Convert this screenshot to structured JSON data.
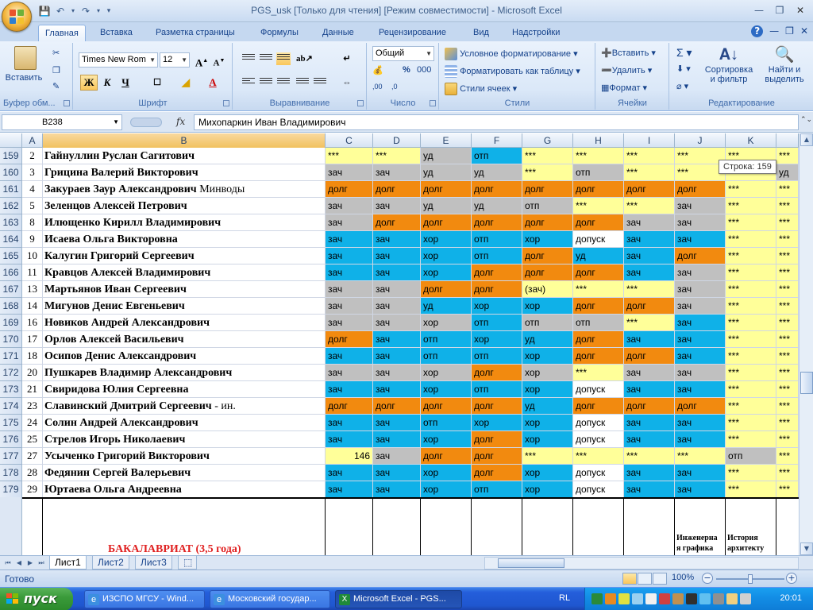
{
  "window": {
    "title": "PGS_usk  [Только для чтения]  [Режим совместимости] - Microsoft Excel"
  },
  "qat": {
    "save_icon": "save-icon",
    "undo_icon": "undo-icon",
    "redo_icon": "redo-icon"
  },
  "ribbon_tabs": [
    "Главная",
    "Вставка",
    "Разметка страницы",
    "Формулы",
    "Данные",
    "Рецензирование",
    "Вид",
    "Надстройки"
  ],
  "ribbon": {
    "clipboard": {
      "paste": "Вставить",
      "label": "Буфер обм..."
    },
    "font": {
      "name": "Times New Rom",
      "size": "12",
      "bold": "Ж",
      "italic": "К",
      "underline": "Ч",
      "label": "Шрифт"
    },
    "alignment": {
      "label": "Выравнивание"
    },
    "number": {
      "format": "Общий",
      "percent": "%",
      "thousands": "000",
      "label": "Число"
    },
    "styles": {
      "conditional": "Условное форматирование",
      "as_table": "Форматировать как таблицу",
      "cell_styles": "Стили ячеек",
      "label": "Стили"
    },
    "cells": {
      "insert": "Вставить",
      "delete": "Удалить",
      "format": "Формат",
      "label": "Ячейки"
    },
    "editing": {
      "sort_line1": "Сортировка",
      "sort_line2": "и фильтр",
      "find_line1": "Найти и",
      "find_line2": "выделить",
      "label": "Редактирование"
    }
  },
  "formula_bar": {
    "name_box": "B238",
    "fx": "fx",
    "content": "Михопаркин Иван Владимирович"
  },
  "columns": [
    "A",
    "B",
    "C",
    "D",
    "E",
    "F",
    "G",
    "H",
    "I",
    "J",
    "K"
  ],
  "rows": [
    {
      "row": "159",
      "a": "2",
      "name": "Гайнуллин Руслан Сагитович",
      "extra": "",
      "cells": [
        [
          "***",
          "y"
        ],
        [
          "***",
          "y"
        ],
        [
          "уд",
          "g"
        ],
        [
          "отп",
          "b"
        ],
        [
          "***",
          "y"
        ],
        [
          "***",
          "y"
        ],
        [
          "***",
          "y"
        ],
        [
          "***",
          "y"
        ],
        [
          "***",
          "y"
        ],
        [
          "***",
          "y"
        ]
      ]
    },
    {
      "row": "160",
      "a": "3",
      "name": "Грицина Валерий Викторович",
      "extra": "",
      "cells": [
        [
          "зач",
          "g"
        ],
        [
          "зач",
          "g"
        ],
        [
          "уд",
          "g"
        ],
        [
          "уд",
          "g"
        ],
        [
          "***",
          "y"
        ],
        [
          "отп",
          "g"
        ],
        [
          "***",
          "y"
        ],
        [
          "***",
          "y"
        ],
        [
          "",
          "y"
        ],
        [
          "уд",
          "g"
        ]
      ]
    },
    {
      "row": "161",
      "a": "4",
      "name": "Закураев Заур Александрович",
      "extra": " Минводы",
      "cells": [
        [
          "долг",
          "o"
        ],
        [
          "долг",
          "o"
        ],
        [
          "долг",
          "o"
        ],
        [
          "долг",
          "o"
        ],
        [
          "долг",
          "o"
        ],
        [
          "долг",
          "o"
        ],
        [
          "долг",
          "o"
        ],
        [
          "долг",
          "o"
        ],
        [
          "***",
          "y"
        ],
        [
          "***",
          "y"
        ]
      ]
    },
    {
      "row": "162",
      "a": "5",
      "name": "Зеленцов Алексей Петрович",
      "extra": "",
      "cells": [
        [
          "зач",
          "g"
        ],
        [
          "зач",
          "g"
        ],
        [
          "уд",
          "g"
        ],
        [
          "уд",
          "g"
        ],
        [
          "отп",
          "g"
        ],
        [
          "***",
          "y"
        ],
        [
          "***",
          "y"
        ],
        [
          "зач",
          "g"
        ],
        [
          "***",
          "y"
        ],
        [
          "***",
          "y"
        ]
      ]
    },
    {
      "row": "163",
      "a": "8",
      "name": "Илющенко Кирилл Владимирович",
      "extra": "",
      "cells": [
        [
          "зач",
          "g"
        ],
        [
          "долг",
          "o"
        ],
        [
          "долг",
          "o"
        ],
        [
          "долг",
          "o"
        ],
        [
          "долг",
          "o"
        ],
        [
          "долг",
          "o"
        ],
        [
          "зач",
          "g"
        ],
        [
          "зач",
          "g"
        ],
        [
          "***",
          "y"
        ],
        [
          "***",
          "y"
        ]
      ]
    },
    {
      "row": "164",
      "a": "9",
      "name": "Исаева Ольга Викторовна",
      "extra": "",
      "cells": [
        [
          "зач",
          "b"
        ],
        [
          "зач",
          "b"
        ],
        [
          "хор",
          "b"
        ],
        [
          "отп",
          "b"
        ],
        [
          "хор",
          "b"
        ],
        [
          "допуск",
          "w"
        ],
        [
          "зач",
          "b"
        ],
        [
          "зач",
          "b"
        ],
        [
          "***",
          "y"
        ],
        [
          "***",
          "y"
        ]
      ]
    },
    {
      "row": "165",
      "a": "10",
      "name": "Калугин Григорий Сергеевич",
      "extra": "",
      "cells": [
        [
          "зач",
          "b"
        ],
        [
          "зач",
          "b"
        ],
        [
          "хор",
          "b"
        ],
        [
          "отп",
          "b"
        ],
        [
          "долг",
          "o"
        ],
        [
          "уд",
          "b"
        ],
        [
          "зач",
          "b"
        ],
        [
          "долг",
          "o"
        ],
        [
          "***",
          "y"
        ],
        [
          "***",
          "y"
        ]
      ]
    },
    {
      "row": "166",
      "a": "11",
      "name": "Кравцов Алексей Владимирович",
      "extra": "",
      "cells": [
        [
          "зач",
          "b"
        ],
        [
          "зач",
          "b"
        ],
        [
          "хор",
          "b"
        ],
        [
          "долг",
          "o"
        ],
        [
          "долг",
          "o"
        ],
        [
          "долг",
          "o"
        ],
        [
          "зач",
          "b"
        ],
        [
          "зач",
          "g"
        ],
        [
          "***",
          "y"
        ],
        [
          "***",
          "y"
        ]
      ]
    },
    {
      "row": "167",
      "a": "13",
      "name": "Мартьянов Иван Сергеевич",
      "extra": "",
      "cells": [
        [
          "зач",
          "g"
        ],
        [
          "зач",
          "g"
        ],
        [
          "долг",
          "o"
        ],
        [
          "долг",
          "o"
        ],
        [
          "(зач)",
          "y"
        ],
        [
          "***",
          "y"
        ],
        [
          "***",
          "y"
        ],
        [
          "зач",
          "g"
        ],
        [
          "***",
          "y"
        ],
        [
          "***",
          "y"
        ]
      ]
    },
    {
      "row": "168",
      "a": "14",
      "name": "Мигунов Денис Евгеньевич",
      "extra": "",
      "cells": [
        [
          "зач",
          "g"
        ],
        [
          "зач",
          "g"
        ],
        [
          "уд",
          "b"
        ],
        [
          "хор",
          "b"
        ],
        [
          "хор",
          "b"
        ],
        [
          "долг",
          "o"
        ],
        [
          "долг",
          "o"
        ],
        [
          "зач",
          "g"
        ],
        [
          "***",
          "y"
        ],
        [
          "***",
          "y"
        ]
      ]
    },
    {
      "row": "169",
      "a": "16",
      "name": "Новиков Андрей Александрович",
      "extra": "",
      "cells": [
        [
          "зач",
          "g"
        ],
        [
          "зач",
          "g"
        ],
        [
          "хор",
          "g"
        ],
        [
          "отп",
          "b"
        ],
        [
          "отп",
          "g"
        ],
        [
          "отп",
          "g"
        ],
        [
          "***",
          "y"
        ],
        [
          "зач",
          "b"
        ],
        [
          "***",
          "y"
        ],
        [
          "***",
          "y"
        ]
      ]
    },
    {
      "row": "170",
      "a": "17",
      "name": "Орлов Алексей Васильевич",
      "extra": "",
      "cells": [
        [
          "долг",
          "o"
        ],
        [
          "зач",
          "b"
        ],
        [
          "отп",
          "b"
        ],
        [
          "хор",
          "b"
        ],
        [
          "уд",
          "b"
        ],
        [
          "долг",
          "o"
        ],
        [
          "зач",
          "b"
        ],
        [
          "зач",
          "b"
        ],
        [
          "***",
          "y"
        ],
        [
          "***",
          "y"
        ]
      ]
    },
    {
      "row": "171",
      "a": "18",
      "name": "Осипов Денис Александрович",
      "extra": "",
      "cells": [
        [
          "зач",
          "b"
        ],
        [
          "зач",
          "b"
        ],
        [
          "отп",
          "b"
        ],
        [
          "отп",
          "b"
        ],
        [
          "хор",
          "b"
        ],
        [
          "долг",
          "o"
        ],
        [
          "долг",
          "o"
        ],
        [
          "зач",
          "b"
        ],
        [
          "***",
          "y"
        ],
        [
          "***",
          "y"
        ]
      ]
    },
    {
      "row": "172",
      "a": "20",
      "name": "Пушкарев Владимир Александрович",
      "extra": "",
      "cells": [
        [
          "зач",
          "g"
        ],
        [
          "зач",
          "g"
        ],
        [
          "хор",
          "g"
        ],
        [
          "долг",
          "o"
        ],
        [
          "хор",
          "g"
        ],
        [
          "***",
          "y"
        ],
        [
          "зач",
          "g"
        ],
        [
          "зач",
          "g"
        ],
        [
          "***",
          "y"
        ],
        [
          "***",
          "y"
        ]
      ]
    },
    {
      "row": "173",
      "a": "21",
      "name": "Свиридова Юлия Сергеевна",
      "extra": "",
      "cells": [
        [
          "зач",
          "b"
        ],
        [
          "зач",
          "b"
        ],
        [
          "хор",
          "b"
        ],
        [
          "отп",
          "b"
        ],
        [
          "хор",
          "b"
        ],
        [
          "допуск",
          "w"
        ],
        [
          "зач",
          "b"
        ],
        [
          "зач",
          "b"
        ],
        [
          "***",
          "y"
        ],
        [
          "***",
          "y"
        ]
      ]
    },
    {
      "row": "174",
      "a": "23",
      "name": "Славинский Дмитрий Сергеевич",
      "extra": " - ин.",
      "cells": [
        [
          "долг",
          "o"
        ],
        [
          "долг",
          "o"
        ],
        [
          "долг",
          "o"
        ],
        [
          "долг",
          "o"
        ],
        [
          "уд",
          "b"
        ],
        [
          "долг",
          "o"
        ],
        [
          "долг",
          "o"
        ],
        [
          "долг",
          "o"
        ],
        [
          "***",
          "y"
        ],
        [
          "***",
          "y"
        ]
      ]
    },
    {
      "row": "175",
      "a": "24",
      "name": "Солин Андрей Александрович",
      "extra": "",
      "cells": [
        [
          "зач",
          "b"
        ],
        [
          "зач",
          "b"
        ],
        [
          "отп",
          "b"
        ],
        [
          "хор",
          "b"
        ],
        [
          "хор",
          "b"
        ],
        [
          "допуск",
          "w"
        ],
        [
          "зач",
          "b"
        ],
        [
          "зач",
          "b"
        ],
        [
          "***",
          "y"
        ],
        [
          "***",
          "y"
        ]
      ]
    },
    {
      "row": "176",
      "a": "25",
      "name": "Стрелов Игорь Николаевич",
      "extra": "",
      "cells": [
        [
          "зач",
          "b"
        ],
        [
          "зач",
          "b"
        ],
        [
          "хор",
          "b"
        ],
        [
          "долг",
          "o"
        ],
        [
          "хор",
          "b"
        ],
        [
          "допуск",
          "w"
        ],
        [
          "зач",
          "b"
        ],
        [
          "зач",
          "b"
        ],
        [
          "***",
          "y"
        ],
        [
          "***",
          "y"
        ]
      ]
    },
    {
      "row": "177",
      "a": "27",
      "name": "Усыченко Григорий Викторович",
      "extra": "",
      "cells": [
        [
          "146",
          "y"
        ],
        [
          "зач",
          "g"
        ],
        [
          "долг",
          "o"
        ],
        [
          "долг",
          "o"
        ],
        [
          "***",
          "y"
        ],
        [
          "***",
          "y"
        ],
        [
          "***",
          "y"
        ],
        [
          "***",
          "y"
        ],
        [
          "отп",
          "g"
        ],
        [
          "***",
          "y"
        ]
      ]
    },
    {
      "row": "178",
      "a": "28",
      "name": "Федянин Сергей Валерьевич",
      "extra": "",
      "cells": [
        [
          "зач",
          "b"
        ],
        [
          "зач",
          "b"
        ],
        [
          "хор",
          "b"
        ],
        [
          "долг",
          "o"
        ],
        [
          "хор",
          "b"
        ],
        [
          "допуск",
          "w"
        ],
        [
          "зач",
          "b"
        ],
        [
          "зач",
          "b"
        ],
        [
          "***",
          "y"
        ],
        [
          "***",
          "y"
        ]
      ]
    },
    {
      "row": "179",
      "a": "29",
      "name": "Юртаева Ольга Андреевна",
      "extra": "",
      "cells": [
        [
          "зач",
          "b"
        ],
        [
          "зач",
          "b"
        ],
        [
          "хор",
          "b"
        ],
        [
          "отп",
          "b"
        ],
        [
          "хор",
          "b"
        ],
        [
          "допуск",
          "w"
        ],
        [
          "зач",
          "b"
        ],
        [
          "зач",
          "b"
        ],
        [
          "***",
          "y"
        ],
        [
          "***",
          "y"
        ]
      ]
    }
  ],
  "footer_block": {
    "bachelor": "БАКАЛАВРИАТ (3,5 года)",
    "j_line1": "Инженерна",
    "j_line2": "я графика",
    "k_line1": "История",
    "k_line2": "архитекту"
  },
  "tooltip": "Строка: 159",
  "sheet_tabs": [
    "Лист1",
    "Лист2",
    "Лист3"
  ],
  "status": {
    "ready": "Готово",
    "zoom": "100%"
  },
  "taskbar": {
    "start": "пуск",
    "tasks": [
      "ИЗСПО МГСУ - Wind...",
      "Московский государ...",
      "Microsoft Excel - PGS..."
    ],
    "lang": "RL",
    "clock": "20:01"
  },
  "colors": {
    "yellow": "#ffff99",
    "grey": "#c0c0c0",
    "blue": "#0fb1e8",
    "orange": "#f28a0f",
    "white": "#ffffff"
  }
}
